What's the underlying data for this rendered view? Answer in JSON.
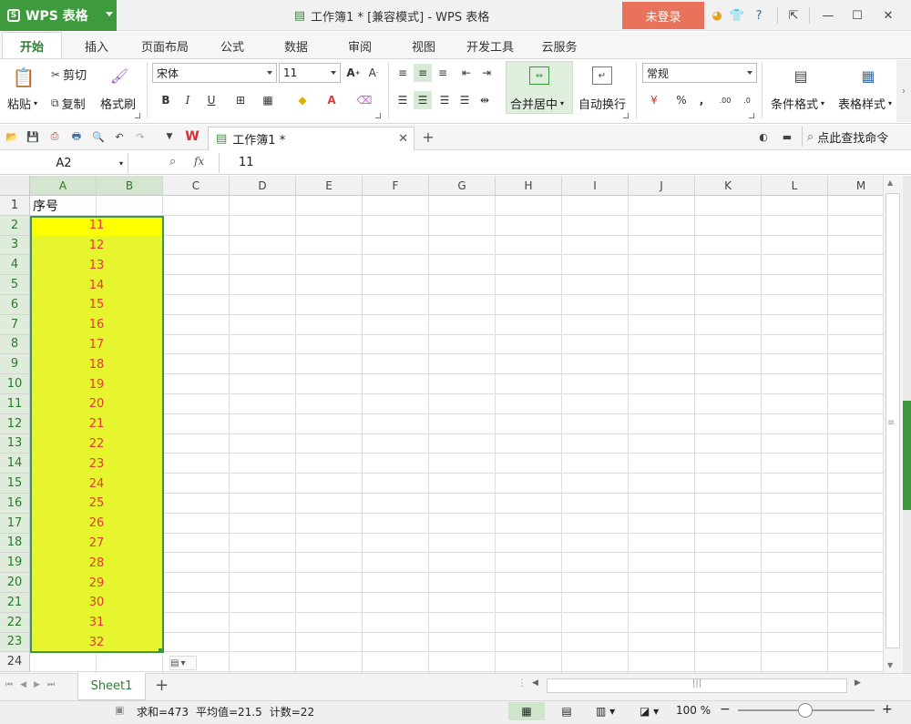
{
  "app": {
    "name": "WPS 表格",
    "doc_title": "工作簿1 * [兼容模式] - WPS 表格",
    "login_label": "未登录"
  },
  "tabs": [
    "开始",
    "插入",
    "页面布局",
    "公式",
    "数据",
    "审阅",
    "视图",
    "开发工具",
    "云服务"
  ],
  "active_tab": "开始",
  "ribbon": {
    "paste": "粘贴",
    "cut": "剪切",
    "copy": "复制",
    "format_painter": "格式刷",
    "font_name": "宋体",
    "font_size": "11",
    "bold": "B",
    "italic": "I",
    "underline": "U",
    "merge_center": "合并居中",
    "wrap_text": "自动换行",
    "number_format": "常规",
    "percent": "%",
    "thousands": ",",
    "cond_format": "条件格式",
    "table_style": "表格样式"
  },
  "quickbar": {
    "doc_tab": "工作簿1 *",
    "find_command": "点此查找命令"
  },
  "formula_bar": {
    "name_box": "A2",
    "fx": "fx",
    "value": "11"
  },
  "grid": {
    "columns": [
      "A",
      "B",
      "C",
      "D",
      "E",
      "F",
      "G",
      "H",
      "I",
      "J",
      "K",
      "L",
      "M"
    ],
    "rows": [
      "1",
      "2",
      "3",
      "4",
      "5",
      "6",
      "7",
      "8",
      "9",
      "10",
      "11",
      "12",
      "13",
      "14",
      "15",
      "16",
      "17",
      "18",
      "19",
      "20",
      "21",
      "22",
      "23",
      "24"
    ],
    "header_cell": "序号",
    "values": [
      "11",
      "12",
      "13",
      "14",
      "15",
      "16",
      "17",
      "18",
      "19",
      "20",
      "21",
      "22",
      "23",
      "24",
      "25",
      "26",
      "27",
      "28",
      "29",
      "30",
      "31",
      "32"
    ],
    "fill_color": "#e6f52e",
    "active_fill": "#ffff00",
    "text_color": "#e53935"
  },
  "sheets": {
    "active": "Sheet1"
  },
  "status": {
    "sum": "求和=473",
    "average": "平均值=21.5",
    "count": "计数=22",
    "zoom": "100 %"
  }
}
